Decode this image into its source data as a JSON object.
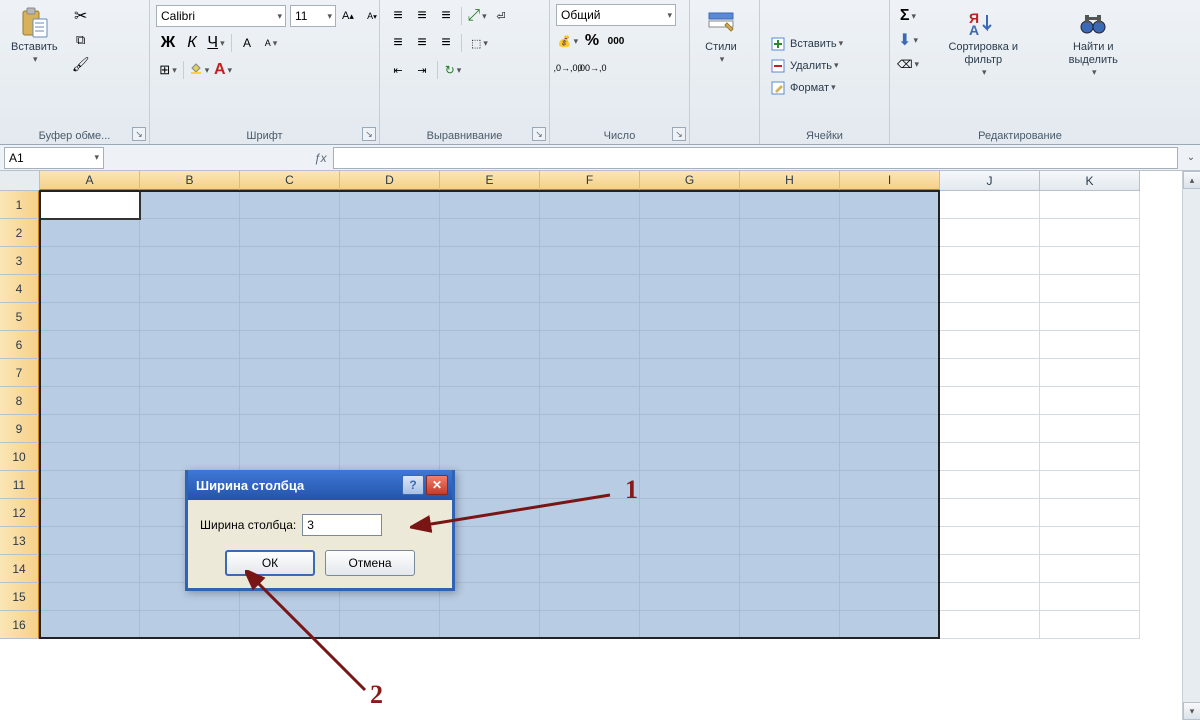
{
  "ribbon": {
    "clipboard": {
      "label": "Буфер обме...",
      "paste": "Вставить"
    },
    "font": {
      "label": "Шрифт",
      "name": "Calibri",
      "size": "11"
    },
    "alignment": {
      "label": "Выравнивание"
    },
    "number": {
      "label": "Число",
      "format": "Общий"
    },
    "styles": {
      "label": "Стили"
    },
    "cells": {
      "label": "Ячейки",
      "insert": "Вставить",
      "delete": "Удалить",
      "format": "Формат"
    },
    "editing": {
      "label": "Редактирование",
      "sort": "Сортировка и фильтр",
      "find": "Найти и выделить"
    }
  },
  "namebox": "A1",
  "columns": [
    "A",
    "B",
    "C",
    "D",
    "E",
    "F",
    "G",
    "H",
    "I",
    "J",
    "K"
  ],
  "rows": [
    "1",
    "2",
    "3",
    "4",
    "5",
    "6",
    "7",
    "8",
    "9",
    "10",
    "11",
    "12",
    "13",
    "14",
    "15",
    "16"
  ],
  "selection": {
    "fromCol": 0,
    "toCol": 8
  },
  "dialog": {
    "title": "Ширина столбца",
    "label": "Ширина столбца:",
    "value": "3",
    "ok": "ОК",
    "cancel": "Отмена"
  },
  "annotations": {
    "one": "1",
    "two": "2"
  }
}
